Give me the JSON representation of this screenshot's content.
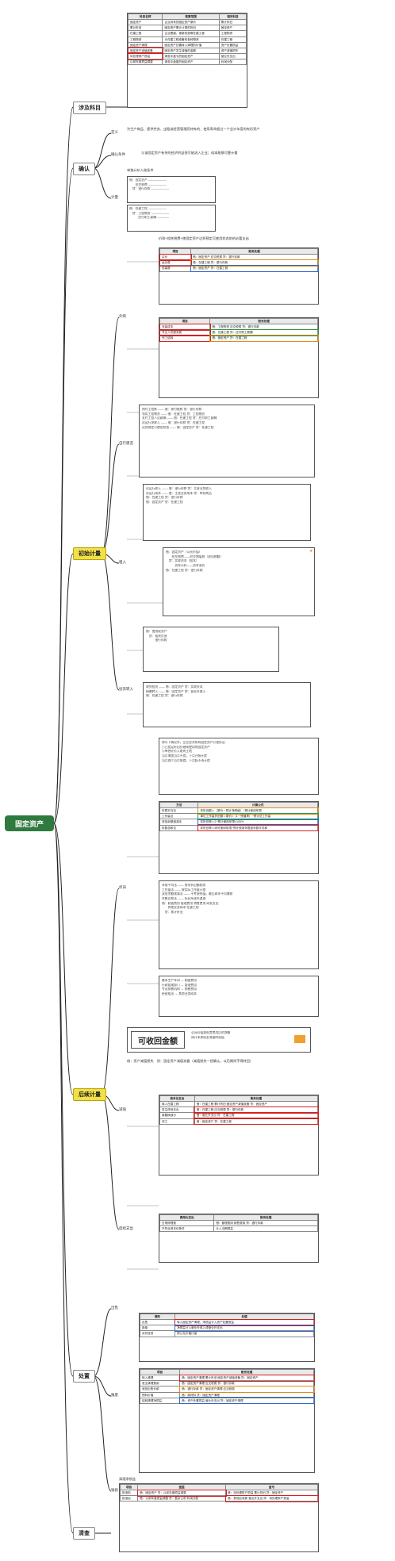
{
  "root": {
    "label": "固定资产"
  },
  "branches": [
    {
      "key": "accounts",
      "label": "涉及科目",
      "highlight": false
    },
    {
      "key": "recognition",
      "label": "确认",
      "highlight": false
    },
    {
      "key": "initial",
      "label": "初始计量",
      "highlight": true
    },
    {
      "key": "subsequent",
      "label": "后续计量",
      "highlight": true
    },
    {
      "key": "disposal",
      "label": "处置",
      "highlight": false
    },
    {
      "key": "inventory",
      "label": "清查",
      "highlight": false
    }
  ],
  "accounts_table": {
    "headers": [
      "科目名称",
      "核算范围",
      "相关科目"
    ],
    "rows": [
      [
        "固定资产",
        "企业持有的固定资产原价",
        "累计折旧"
      ],
      [
        "累计折旧",
        "固定资产累计计提的折旧",
        "固定资产"
      ],
      [
        "在建工程",
        "企业基建、更新改造等在建工程",
        "工程物资"
      ],
      [
        "工程物资",
        "为在建工程准备的各种物资",
        "在建工程"
      ],
      [
        "固定资产清理",
        "固定资产处置转入清理的价值",
        "资产处置损益"
      ],
      [
        "固定资产减值准备",
        "固定资产发生减值的金额",
        "资产减值损失"
      ],
      [
        "待处理财产损溢",
        "清查中盘亏的固定资产",
        "营业外支出"
      ],
      [
        "以前年度损益调整",
        "清查中盘盈的固定资产",
        "利润分配"
      ]
    ]
  },
  "recognition": {
    "items": [
      "定义",
      "确认条件",
      "计量"
    ],
    "definition": "为生产商品、提供劳务、出租或经营管理而持有的、使用寿命超过一个会计年度的有形资产",
    "conditions": "与该固定资产有关的经济利益很可能流入企业；成本能够可靠计量",
    "red_note": "单独计价入账条件"
  },
  "initial": {
    "items": [
      "外购",
      "自行建造",
      "租入",
      "投资转入"
    ],
    "red_note": "价款+相关税费+使固定资产达到预定可使用状态前的必要支出",
    "labels": [
      "买价",
      "运杂费",
      "包装费",
      "安装成本",
      "专业人员服务费"
    ]
  },
  "subsequent": {
    "items": [
      "折旧",
      "减值",
      "后续支出"
    ],
    "methods": [
      "年限平均法",
      "工作量法",
      "双倍余额递减法",
      "年数总和法"
    ],
    "impairment_box": "可收回金额"
  },
  "disposal": {
    "items": [
      "出售",
      "报废",
      "毁损",
      "对外投资"
    ],
    "steps": [
      "转入清理",
      "发生清理费用",
      "收回出售价款",
      "残料价值",
      "结转清理净损益"
    ]
  },
  "inventory": {
    "headers": [
      "项目",
      "盘盈",
      "盘亏"
    ],
    "rows": [
      [
        "批准前",
        "借：固定资产 贷：以前年度损益调整",
        "借：待处理财产损溢 累计折旧 贷：固定资产"
      ],
      [
        "批准后",
        "借：以前年度损益调整 贷：盈余公积 利润分配",
        "借：其他应收款 营业外支出 贷：待处理财产损溢"
      ]
    ]
  },
  "table_headers": {
    "item": "项目",
    "entry": "账务处理"
  },
  "icons": {
    "warning": "warning-icon",
    "star": "star-icon"
  }
}
